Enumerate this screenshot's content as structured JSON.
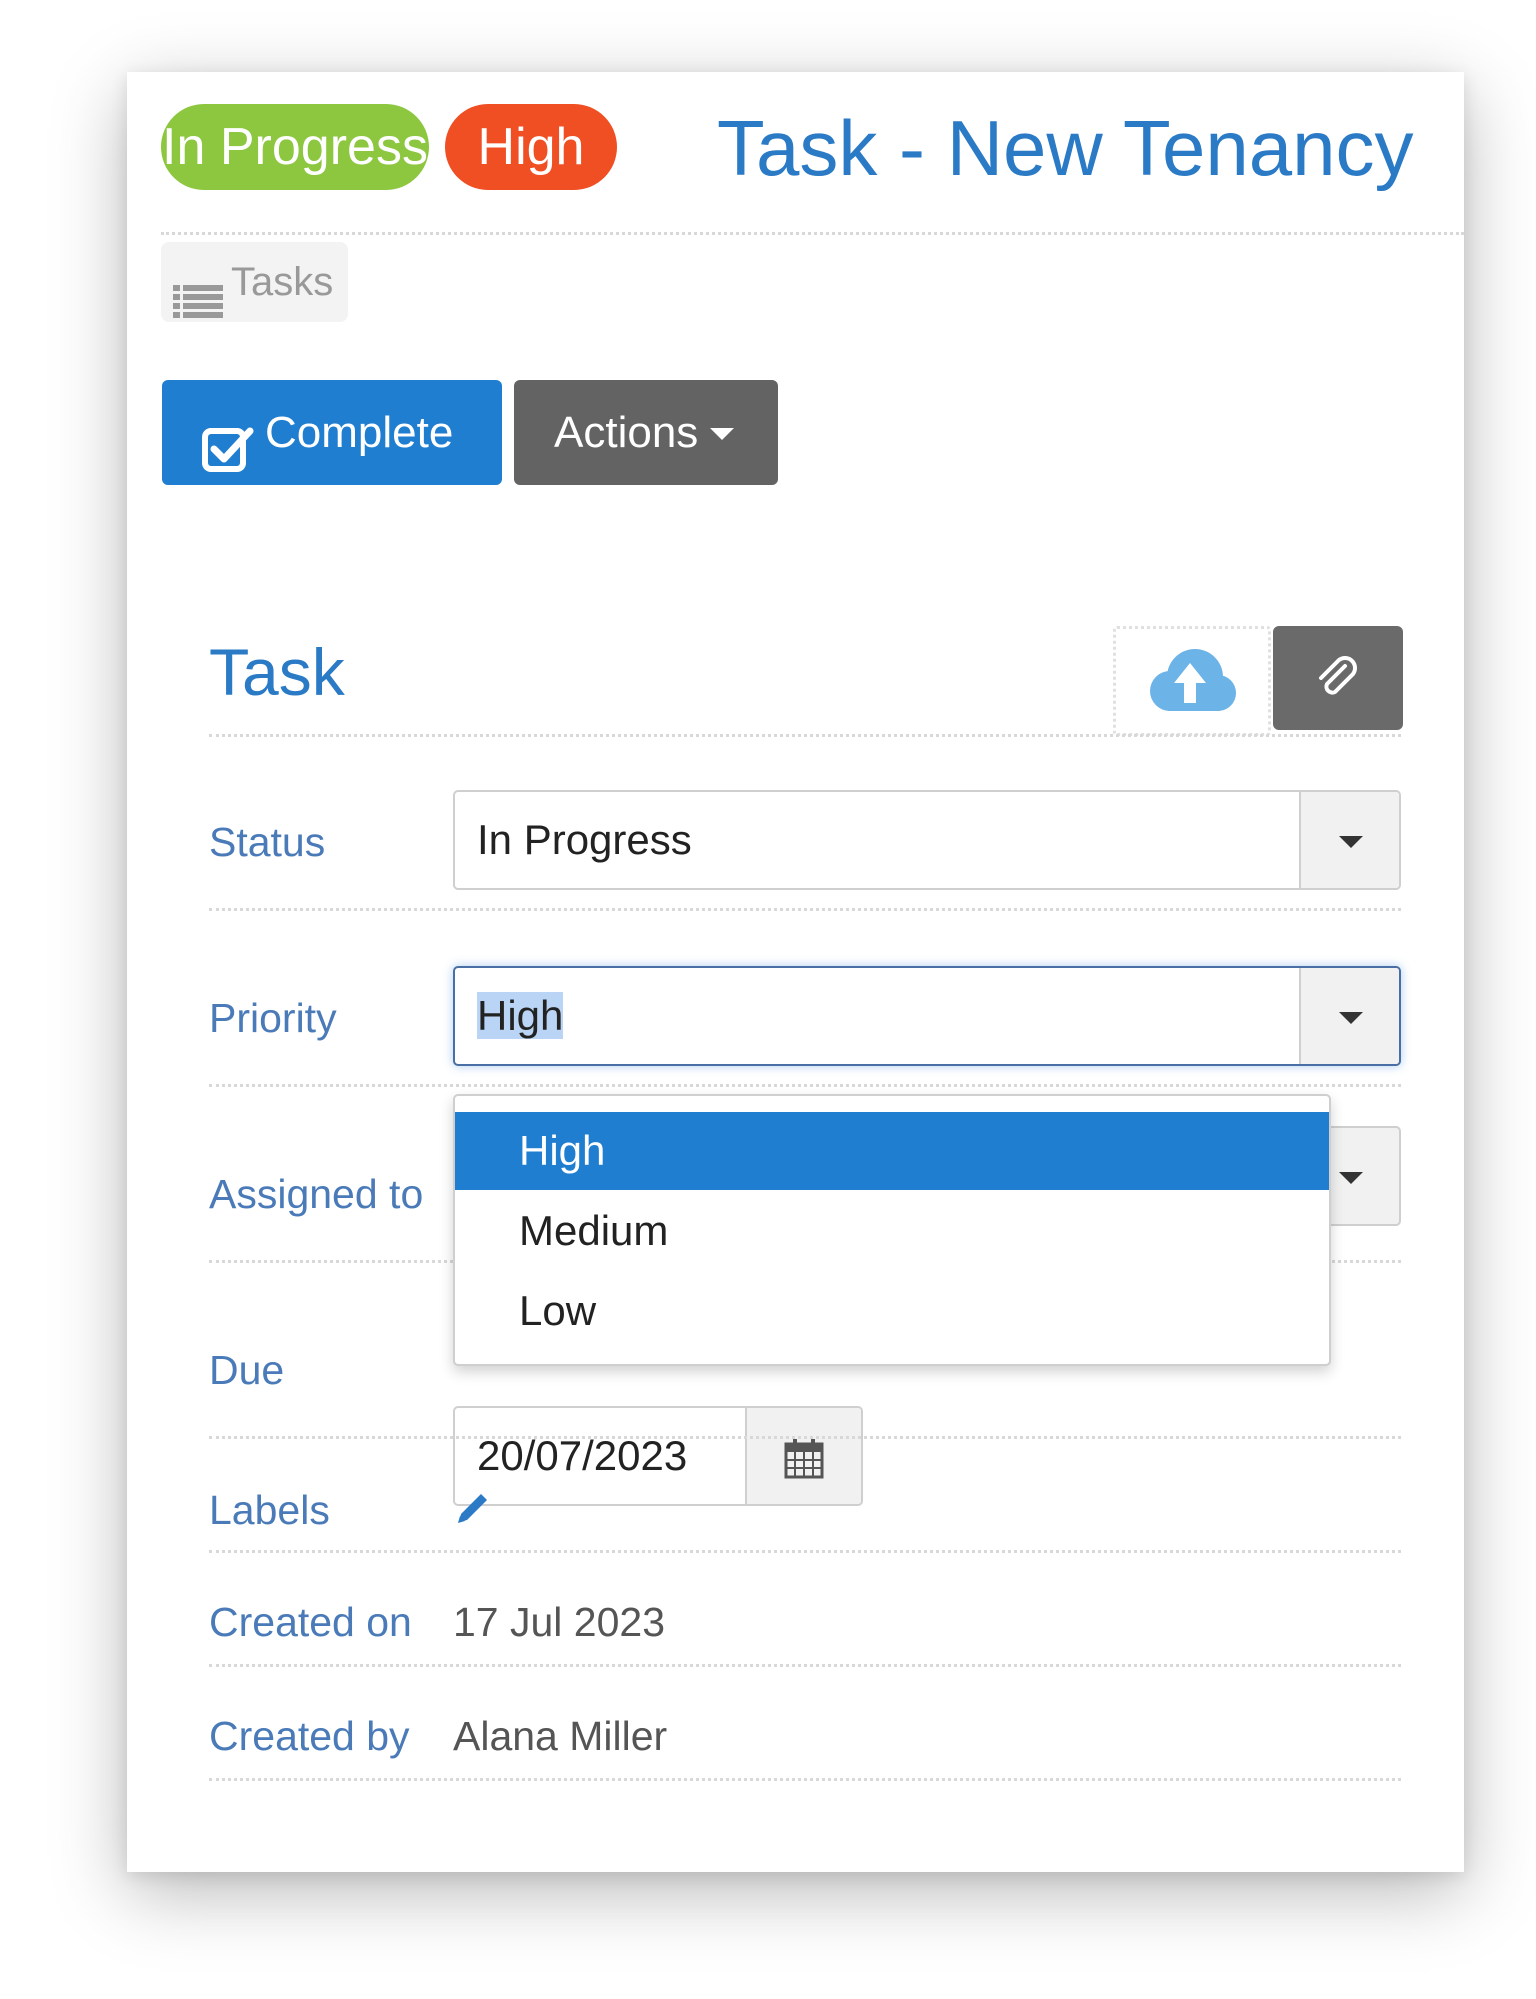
{
  "header": {
    "status_badge": "In Progress",
    "priority_badge": "High",
    "title": "Task - New Tenancy"
  },
  "breadcrumb": {
    "tasks_label": "Tasks"
  },
  "toolbar": {
    "complete_label": "Complete",
    "actions_label": "Actions"
  },
  "section": {
    "title": "Task"
  },
  "form": {
    "status_label": "Status",
    "status_value": "In Progress",
    "priority_label": "Priority",
    "priority_value": "High",
    "priority_options": [
      "High",
      "Medium",
      "Low"
    ],
    "assigned_label": "Assigned to",
    "due_label": "Due",
    "due_value": "20/07/2023",
    "labels_label": "Labels",
    "created_on_label": "Created on",
    "created_on_value": "17 Jul 2023",
    "created_by_label": "Created by",
    "created_by_value": "Alana Miller"
  },
  "icons": {
    "tasks": "list-icon",
    "complete": "checkbox-check-icon",
    "actions_caret": "caret-down-icon",
    "upload": "cloud-upload-icon",
    "attach": "paperclip-icon",
    "calendar": "calendar-icon",
    "labels_edit": "pencil-icon"
  },
  "colors": {
    "status_badge": "#8dc63f",
    "priority_badge": "#f04e23",
    "primary": "#1f7ed0",
    "secondary": "#636363",
    "title": "#2a7ac6",
    "label": "#4a7bb8"
  }
}
